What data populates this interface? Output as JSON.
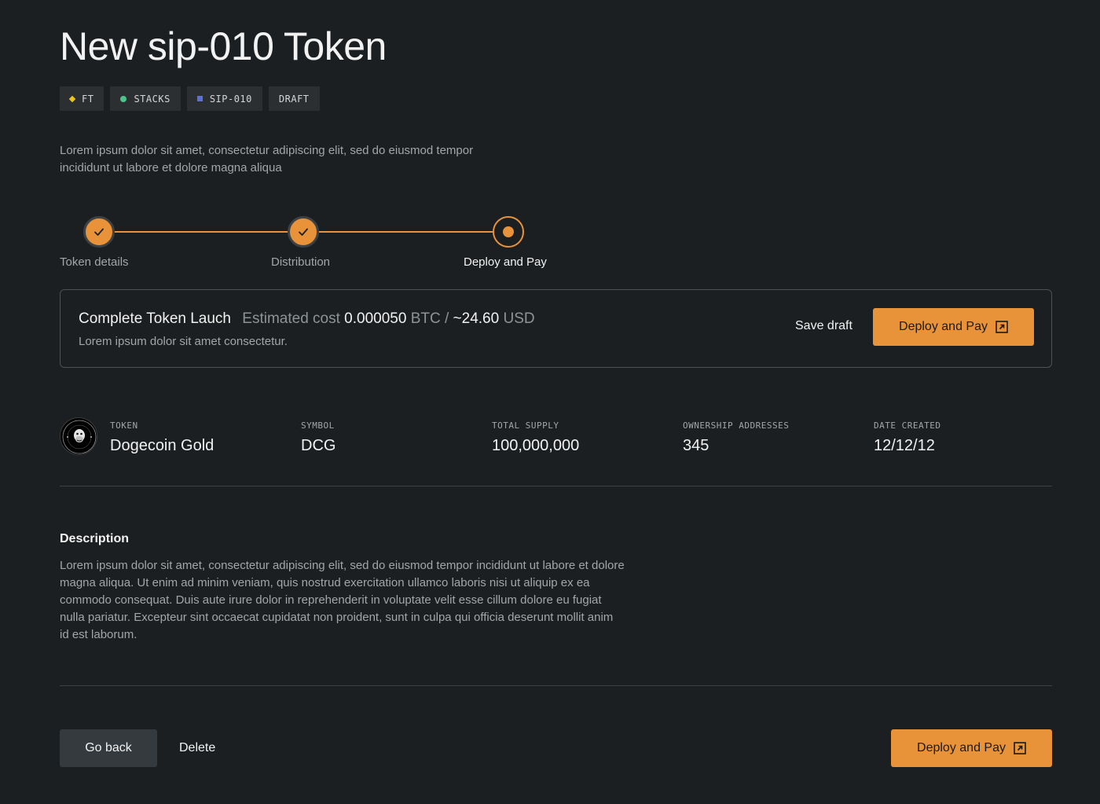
{
  "page": {
    "title": "New sip-010 Token",
    "intro": "Lorem ipsum dolor sit amet, consectetur adipiscing elit, sed do eiusmod tempor incididunt ut labore et dolore magna aliqua"
  },
  "tags": [
    {
      "label": "FT",
      "icon": "diamond-icon",
      "color": "#f0c419"
    },
    {
      "label": "STACKS",
      "icon": "circle-icon",
      "color": "#4cc38a"
    },
    {
      "label": "SIP-010",
      "icon": "square-icon",
      "color": "#5d6fd8"
    },
    {
      "label": "DRAFT"
    }
  ],
  "steps": [
    {
      "label": "Token details",
      "status": "complete",
      "icon": "check-icon"
    },
    {
      "label": "Distribution",
      "status": "complete",
      "icon": "check-icon"
    },
    {
      "label": "Deploy and Pay",
      "status": "current",
      "icon": "dot-icon"
    }
  ],
  "launch": {
    "title": "Complete Token Lauch",
    "cost_prefix": "Estimated cost",
    "btc_value": "0.000050",
    "btc_unit": "BTC /",
    "usd_value": "~24.60",
    "usd_unit": "USD",
    "subtitle": "Lorem ipsum dolor sit amet consectetur.",
    "save_label": "Save draft",
    "deploy_label": "Deploy and Pay"
  },
  "token_info": {
    "avatar_icon": "ape-avatar-icon",
    "token_label": "TOKEN",
    "token_value": "Dogecoin Gold",
    "symbol_label": "SYMBOL",
    "symbol_value": "DCG",
    "supply_label": "TOTAL SUPPLY",
    "supply_value": "100,000,000",
    "ownership_label": "OWNERSHIP ADDRESSES",
    "ownership_value": "345",
    "date_label": "DATE CREATED",
    "date_value": "12/12/12"
  },
  "description": {
    "title": "Description",
    "body": "Lorem ipsum dolor sit amet, consectetur adipiscing elit, sed do eiusmod tempor incididunt ut labore et dolore magna aliqua. Ut enim ad minim veniam, quis nostrud exercitation ullamco laboris nisi ut aliquip ex ea commodo consequat. Duis aute irure dolor in reprehenderit in voluptate velit esse cillum dolore eu fugiat nulla pariatur. Excepteur sint occaecat cupidatat non proident, sunt in culpa qui officia deserunt mollit anim id est laborum."
  },
  "footer": {
    "back_label": "Go back",
    "delete_label": "Delete",
    "deploy_label": "Deploy and Pay"
  },
  "colors": {
    "accent": "#e8923a",
    "background": "#1c1f21",
    "surface": "#2b2f32"
  }
}
